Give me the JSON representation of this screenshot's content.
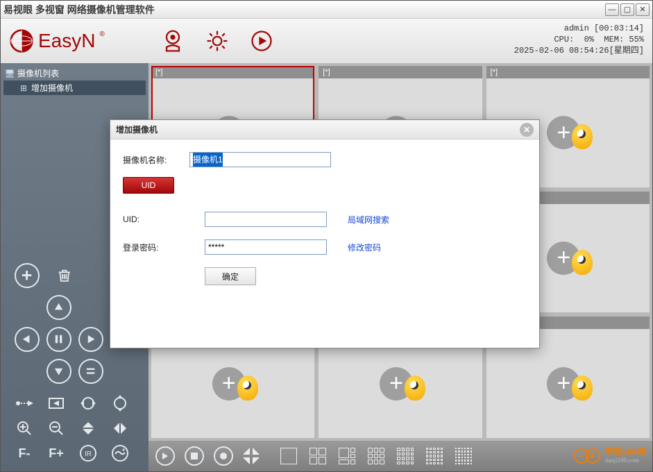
{
  "titlebar": {
    "text": "易视眼 多视窗 网络摄像机管理软件"
  },
  "header": {
    "brand": "EasyN",
    "sysinfo": {
      "user": "admin",
      "uptime": "[00:03:14]",
      "cpu_label": "CPU:",
      "cpu_value": "0%",
      "mem_label": "MEM:",
      "mem_value": "55%",
      "datetime": "2025-02-06 08:54:26",
      "weekday": "[星期四]"
    }
  },
  "sidebar": {
    "tree_root": "摄像机列表",
    "tree_child": "增加摄像机",
    "ctrl": {
      "fminus": "F-",
      "fplus": "F+"
    }
  },
  "grid": {
    "headers": [
      "[*]",
      "[*]",
      "[*]",
      "",
      "",
      "",
      "",
      "",
      ""
    ]
  },
  "modal": {
    "title": "增加摄像机",
    "name_label": "摄像机名称:",
    "name_value": "摄像机1",
    "uid_btn": "UID",
    "uid_label": "UID:",
    "uid_value": "",
    "search_link": "局域网搜索",
    "pwd_label": "登录密码:",
    "pwd_value": "*****",
    "changepwd_link": "修改密码",
    "ok_label": "确定"
  },
  "footer": {
    "brand_zh": "单机100网",
    "brand_en": "danji100.com"
  }
}
